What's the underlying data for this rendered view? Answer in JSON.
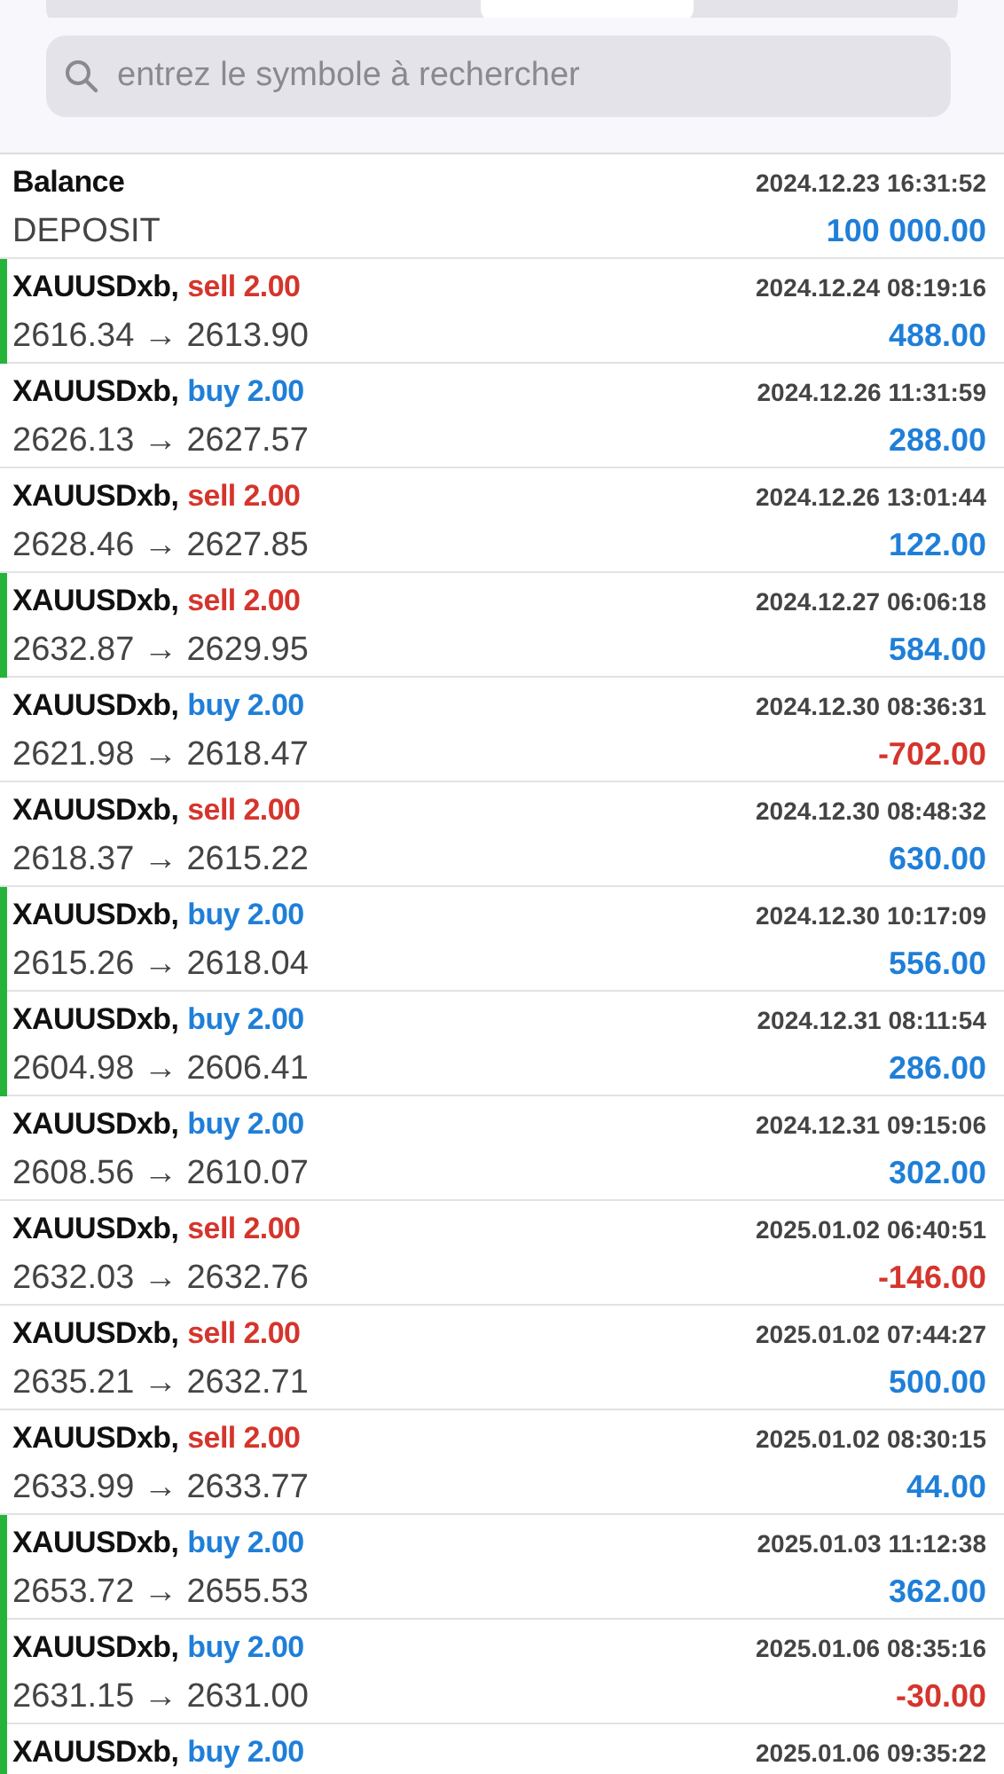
{
  "segments": [
    {
      "selected": false
    },
    {
      "selected": true
    },
    {
      "selected": false
    }
  ],
  "search": {
    "placeholder": "entrez le symbole à rechercher"
  },
  "deals": [
    {
      "kind": "balance",
      "symbol": "Balance",
      "time": "2024.12.23 16:31:52",
      "comment": "DEPOSIT",
      "profit": "100 000.00",
      "loss": false,
      "marked": false
    },
    {
      "kind": "trade",
      "symbol": "XAUUSDxb,",
      "order": {
        "text": "sell 2.00",
        "color": "#d5352c"
      },
      "time": "2024.12.24 08:19:16",
      "prices": "2616.34 → 2613.90",
      "profit": "488.00",
      "loss": false,
      "marked": true
    },
    {
      "kind": "trade",
      "symbol": "XAUUSDxb,",
      "order": {
        "text": "buy 2.00",
        "color": "#1f7fd8"
      },
      "time": "2024.12.26 11:31:59",
      "prices": "2626.13 → 2627.57",
      "profit": "288.00",
      "loss": false,
      "marked": false
    },
    {
      "kind": "trade",
      "symbol": "XAUUSDxb,",
      "order": {
        "text": "sell 2.00",
        "color": "#d5352c"
      },
      "time": "2024.12.26 13:01:44",
      "prices": "2628.46 → 2627.85",
      "profit": "122.00",
      "loss": false,
      "marked": false
    },
    {
      "kind": "trade",
      "symbol": "XAUUSDxb,",
      "order": {
        "text": "sell 2.00",
        "color": "#d5352c"
      },
      "time": "2024.12.27 06:06:18",
      "prices": "2632.87 → 2629.95",
      "profit": "584.00",
      "loss": false,
      "marked": true
    },
    {
      "kind": "trade",
      "symbol": "XAUUSDxb,",
      "order": {
        "text": "buy 2.00",
        "color": "#1f7fd8"
      },
      "time": "2024.12.30 08:36:31",
      "prices": "2621.98 → 2618.47",
      "profit": "-702.00",
      "loss": true,
      "marked": false
    },
    {
      "kind": "trade",
      "symbol": "XAUUSDxb,",
      "order": {
        "text": "sell 2.00",
        "color": "#d5352c"
      },
      "time": "2024.12.30 08:48:32",
      "prices": "2618.37 → 2615.22",
      "profit": "630.00",
      "loss": false,
      "marked": false
    },
    {
      "kind": "trade",
      "symbol": "XAUUSDxb,",
      "order": {
        "text": "buy 2.00",
        "color": "#1f7fd8"
      },
      "time": "2024.12.30 10:17:09",
      "prices": "2615.26 → 2618.04",
      "profit": "556.00",
      "loss": false,
      "marked": true
    },
    {
      "kind": "trade",
      "symbol": "XAUUSDxb,",
      "order": {
        "text": "buy 2.00",
        "color": "#1f7fd8"
      },
      "time": "2024.12.31 08:11:54",
      "prices": "2604.98 → 2606.41",
      "profit": "286.00",
      "loss": false,
      "marked": true
    },
    {
      "kind": "trade",
      "symbol": "XAUUSDxb,",
      "order": {
        "text": "buy 2.00",
        "color": "#1f7fd8"
      },
      "time": "2024.12.31 09:15:06",
      "prices": "2608.56 → 2610.07",
      "profit": "302.00",
      "loss": false,
      "marked": false
    },
    {
      "kind": "trade",
      "symbol": "XAUUSDxb,",
      "order": {
        "text": "sell 2.00",
        "color": "#d5352c"
      },
      "time": "2025.01.02 06:40:51",
      "prices": "2632.03 → 2632.76",
      "profit": "-146.00",
      "loss": true,
      "marked": false
    },
    {
      "kind": "trade",
      "symbol": "XAUUSDxb,",
      "order": {
        "text": "sell 2.00",
        "color": "#d5352c"
      },
      "time": "2025.01.02 07:44:27",
      "prices": "2635.21 → 2632.71",
      "profit": "500.00",
      "loss": false,
      "marked": false
    },
    {
      "kind": "trade",
      "symbol": "XAUUSDxb,",
      "order": {
        "text": "sell 2.00",
        "color": "#d5352c"
      },
      "time": "2025.01.02 08:30:15",
      "prices": "2633.99 → 2633.77",
      "profit": "44.00",
      "loss": false,
      "marked": false
    },
    {
      "kind": "trade",
      "symbol": "XAUUSDxb,",
      "order": {
        "text": "buy 2.00",
        "color": "#1f7fd8"
      },
      "time": "2025.01.03 11:12:38",
      "prices": "2653.72 → 2655.53",
      "profit": "362.00",
      "loss": false,
      "marked": true
    },
    {
      "kind": "trade",
      "symbol": "XAUUSDxb,",
      "order": {
        "text": "buy 2.00",
        "color": "#1f7fd8"
      },
      "time": "2025.01.06 08:35:16",
      "prices": "2631.15 → 2631.00",
      "profit": "-30.00",
      "loss": true,
      "marked": true
    },
    {
      "kind": "trade",
      "symbol": "XAUUSDxb,",
      "order": {
        "text": "buy 2.00",
        "color": "#1f7fd8"
      },
      "time": "2025.01.06 09:35:22",
      "marked": true
    }
  ]
}
